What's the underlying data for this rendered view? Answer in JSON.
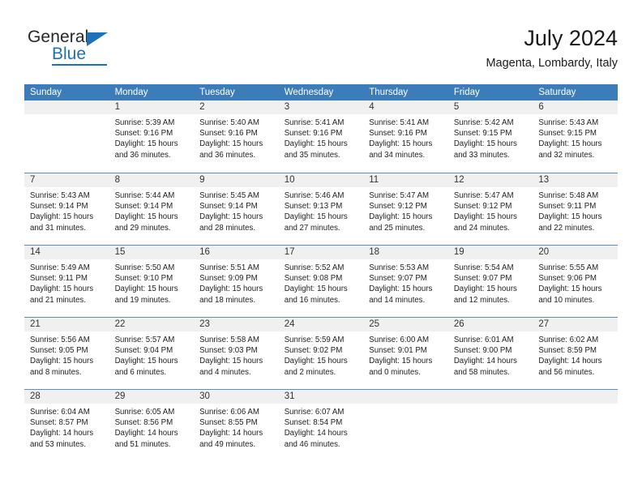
{
  "logo": {
    "word1": "General",
    "word2": "Blue",
    "triangle_color": "#1b72b8"
  },
  "header": {
    "title": "July 2024",
    "subtitle": "Magenta, Lombardy, Italy"
  },
  "theme": {
    "header_blue": "#3b7cb9",
    "daynum_gray": "#f0f0f0",
    "grid_line": "#5a8fc4",
    "text": "#222222"
  },
  "calendar": {
    "weekday_headers": [
      "Sunday",
      "Monday",
      "Tuesday",
      "Wednesday",
      "Thursday",
      "Friday",
      "Saturday"
    ],
    "weeks": [
      [
        {
          "day": "",
          "lines": [
            "",
            "",
            "",
            ""
          ]
        },
        {
          "day": "1",
          "lines": [
            "Sunrise: 5:39 AM",
            "Sunset: 9:16 PM",
            "Daylight: 15 hours",
            "and 36 minutes."
          ]
        },
        {
          "day": "2",
          "lines": [
            "Sunrise: 5:40 AM",
            "Sunset: 9:16 PM",
            "Daylight: 15 hours",
            "and 36 minutes."
          ]
        },
        {
          "day": "3",
          "lines": [
            "Sunrise: 5:41 AM",
            "Sunset: 9:16 PM",
            "Daylight: 15 hours",
            "and 35 minutes."
          ]
        },
        {
          "day": "4",
          "lines": [
            "Sunrise: 5:41 AM",
            "Sunset: 9:16 PM",
            "Daylight: 15 hours",
            "and 34 minutes."
          ]
        },
        {
          "day": "5",
          "lines": [
            "Sunrise: 5:42 AM",
            "Sunset: 9:15 PM",
            "Daylight: 15 hours",
            "and 33 minutes."
          ]
        },
        {
          "day": "6",
          "lines": [
            "Sunrise: 5:43 AM",
            "Sunset: 9:15 PM",
            "Daylight: 15 hours",
            "and 32 minutes."
          ]
        }
      ],
      [
        {
          "day": "7",
          "lines": [
            "Sunrise: 5:43 AM",
            "Sunset: 9:14 PM",
            "Daylight: 15 hours",
            "and 31 minutes."
          ]
        },
        {
          "day": "8",
          "lines": [
            "Sunrise: 5:44 AM",
            "Sunset: 9:14 PM",
            "Daylight: 15 hours",
            "and 29 minutes."
          ]
        },
        {
          "day": "9",
          "lines": [
            "Sunrise: 5:45 AM",
            "Sunset: 9:14 PM",
            "Daylight: 15 hours",
            "and 28 minutes."
          ]
        },
        {
          "day": "10",
          "lines": [
            "Sunrise: 5:46 AM",
            "Sunset: 9:13 PM",
            "Daylight: 15 hours",
            "and 27 minutes."
          ]
        },
        {
          "day": "11",
          "lines": [
            "Sunrise: 5:47 AM",
            "Sunset: 9:12 PM",
            "Daylight: 15 hours",
            "and 25 minutes."
          ]
        },
        {
          "day": "12",
          "lines": [
            "Sunrise: 5:47 AM",
            "Sunset: 9:12 PM",
            "Daylight: 15 hours",
            "and 24 minutes."
          ]
        },
        {
          "day": "13",
          "lines": [
            "Sunrise: 5:48 AM",
            "Sunset: 9:11 PM",
            "Daylight: 15 hours",
            "and 22 minutes."
          ]
        }
      ],
      [
        {
          "day": "14",
          "lines": [
            "Sunrise: 5:49 AM",
            "Sunset: 9:11 PM",
            "Daylight: 15 hours",
            "and 21 minutes."
          ]
        },
        {
          "day": "15",
          "lines": [
            "Sunrise: 5:50 AM",
            "Sunset: 9:10 PM",
            "Daylight: 15 hours",
            "and 19 minutes."
          ]
        },
        {
          "day": "16",
          "lines": [
            "Sunrise: 5:51 AM",
            "Sunset: 9:09 PM",
            "Daylight: 15 hours",
            "and 18 minutes."
          ]
        },
        {
          "day": "17",
          "lines": [
            "Sunrise: 5:52 AM",
            "Sunset: 9:08 PM",
            "Daylight: 15 hours",
            "and 16 minutes."
          ]
        },
        {
          "day": "18",
          "lines": [
            "Sunrise: 5:53 AM",
            "Sunset: 9:07 PM",
            "Daylight: 15 hours",
            "and 14 minutes."
          ]
        },
        {
          "day": "19",
          "lines": [
            "Sunrise: 5:54 AM",
            "Sunset: 9:07 PM",
            "Daylight: 15 hours",
            "and 12 minutes."
          ]
        },
        {
          "day": "20",
          "lines": [
            "Sunrise: 5:55 AM",
            "Sunset: 9:06 PM",
            "Daylight: 15 hours",
            "and 10 minutes."
          ]
        }
      ],
      [
        {
          "day": "21",
          "lines": [
            "Sunrise: 5:56 AM",
            "Sunset: 9:05 PM",
            "Daylight: 15 hours",
            "and 8 minutes."
          ]
        },
        {
          "day": "22",
          "lines": [
            "Sunrise: 5:57 AM",
            "Sunset: 9:04 PM",
            "Daylight: 15 hours",
            "and 6 minutes."
          ]
        },
        {
          "day": "23",
          "lines": [
            "Sunrise: 5:58 AM",
            "Sunset: 9:03 PM",
            "Daylight: 15 hours",
            "and 4 minutes."
          ]
        },
        {
          "day": "24",
          "lines": [
            "Sunrise: 5:59 AM",
            "Sunset: 9:02 PM",
            "Daylight: 15 hours",
            "and 2 minutes."
          ]
        },
        {
          "day": "25",
          "lines": [
            "Sunrise: 6:00 AM",
            "Sunset: 9:01 PM",
            "Daylight: 15 hours",
            "and 0 minutes."
          ]
        },
        {
          "day": "26",
          "lines": [
            "Sunrise: 6:01 AM",
            "Sunset: 9:00 PM",
            "Daylight: 14 hours",
            "and 58 minutes."
          ]
        },
        {
          "day": "27",
          "lines": [
            "Sunrise: 6:02 AM",
            "Sunset: 8:59 PM",
            "Daylight: 14 hours",
            "and 56 minutes."
          ]
        }
      ],
      [
        {
          "day": "28",
          "lines": [
            "Sunrise: 6:04 AM",
            "Sunset: 8:57 PM",
            "Daylight: 14 hours",
            "and 53 minutes."
          ]
        },
        {
          "day": "29",
          "lines": [
            "Sunrise: 6:05 AM",
            "Sunset: 8:56 PM",
            "Daylight: 14 hours",
            "and 51 minutes."
          ]
        },
        {
          "day": "30",
          "lines": [
            "Sunrise: 6:06 AM",
            "Sunset: 8:55 PM",
            "Daylight: 14 hours",
            "and 49 minutes."
          ]
        },
        {
          "day": "31",
          "lines": [
            "Sunrise: 6:07 AM",
            "Sunset: 8:54 PM",
            "Daylight: 14 hours",
            "and 46 minutes."
          ]
        },
        {
          "day": "",
          "lines": [
            "",
            "",
            "",
            ""
          ]
        },
        {
          "day": "",
          "lines": [
            "",
            "",
            "",
            ""
          ]
        },
        {
          "day": "",
          "lines": [
            "",
            "",
            "",
            ""
          ]
        }
      ]
    ]
  }
}
